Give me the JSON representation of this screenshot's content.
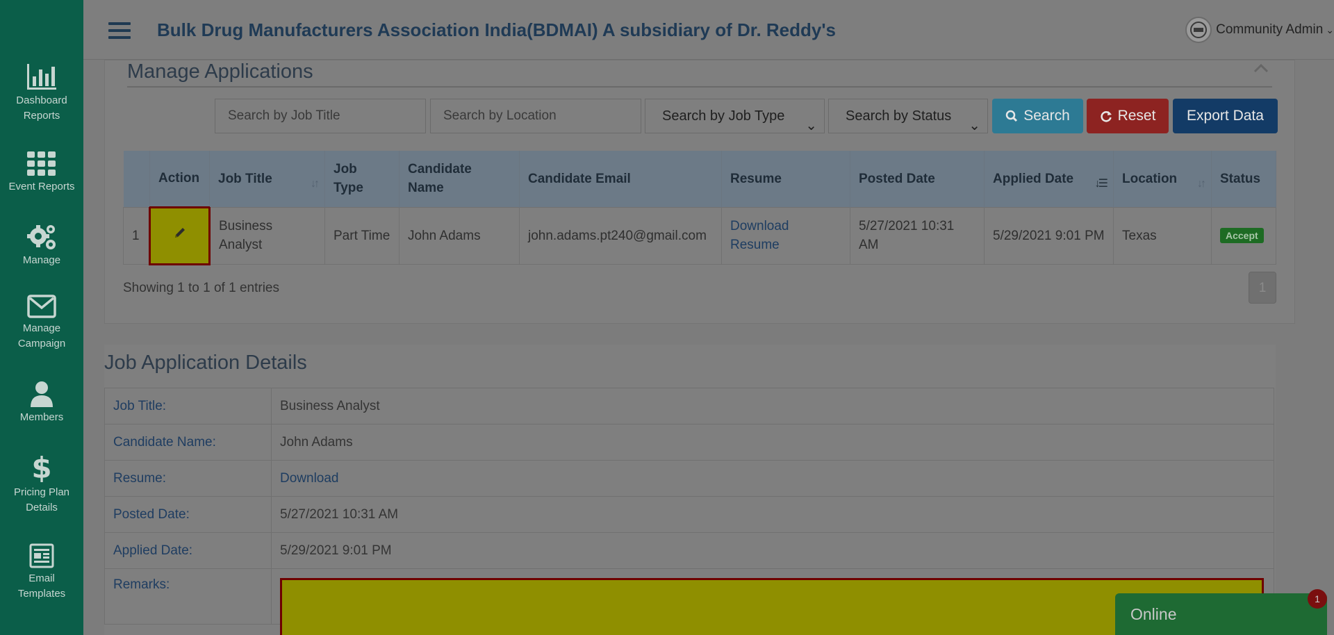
{
  "header": {
    "title": "Bulk Drug Manufacturers Association India(BDMAI) A subsidiary of Dr. Reddy's",
    "user_label": "Community Admin"
  },
  "sidebar": {
    "items": [
      {
        "label": "Dashboard\nReports",
        "icon": "bar-chart-icon"
      },
      {
        "label": "Event Reports",
        "icon": "grid-icon"
      },
      {
        "label": "Manage",
        "icon": "gears-icon"
      },
      {
        "label": "Manage\nCampaign",
        "icon": "envelope-icon"
      },
      {
        "label": "Members",
        "icon": "user-icon"
      },
      {
        "label": "Pricing Plan\nDetails",
        "icon": "dollar-icon"
      },
      {
        "label": "Email\nTemplates",
        "icon": "document-icon"
      }
    ]
  },
  "manage": {
    "title": "Manage Applications",
    "filters": {
      "job_title_placeholder": "Search by Job Title",
      "location_placeholder": "Search by Location",
      "job_type_selected": "Search by Job Type",
      "status_selected": "Search by Status"
    },
    "buttons": {
      "search": "Search",
      "reset": "Reset",
      "export": "Export Data"
    },
    "table": {
      "columns": [
        "",
        "Action",
        "Job Title",
        "Job\nType",
        "Candidate\nName",
        "Candidate Email",
        "Resume",
        "Posted Date",
        "Applied Date",
        "Location",
        "Status"
      ],
      "rows": [
        {
          "index": "1",
          "job_title": "Business Analyst",
          "job_type": "Part Time",
          "candidate_name": "John Adams",
          "candidate_email": "john.adams.pt240@gmail.com",
          "resume": "Download Resume",
          "posted_date": "5/27/2021 10:31 AM",
          "applied_date": "5/29/2021 9:01 PM",
          "location": "Texas",
          "status": "Accept"
        }
      ]
    },
    "showing": "Showing 1 to 1 of 1 entries",
    "page": "1"
  },
  "details": {
    "title": "Job Application Details",
    "rows": [
      {
        "label": "Job Title:",
        "value": "Business Analyst"
      },
      {
        "label": "Candidate Name:",
        "value": "John Adams"
      },
      {
        "label": "Resume:",
        "value": "Download"
      },
      {
        "label": "Posted Date:",
        "value": "5/27/2021 10:31 AM"
      },
      {
        "label": "Applied Date:",
        "value": "5/29/2021 9:01 PM"
      },
      {
        "label": "Remarks:",
        "value": ""
      }
    ]
  },
  "chat": {
    "label": "Online",
    "badge_count": "1"
  },
  "colors": {
    "sidebar": "#0b5e49",
    "search_button": "#2d7a94",
    "reset_button": "#8d2321",
    "export_button": "#133b66",
    "highlight": "#8f8f00",
    "online": "#1e6a33"
  }
}
